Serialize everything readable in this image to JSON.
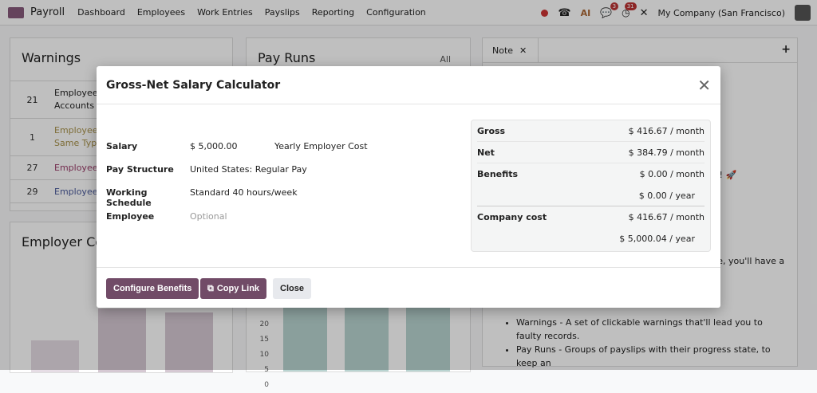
{
  "nav": {
    "app": "Payroll",
    "menu": [
      "Dashboard",
      "Employees",
      "Work Entries",
      "Payslips",
      "Reporting",
      "Configuration"
    ],
    "chat_count": "3",
    "activity_count": "31",
    "company": "My Company (San Francisco)"
  },
  "warnings": {
    "title": "Warnings",
    "rows": [
      {
        "count": "21",
        "text": "Employees",
        "text2": "Accounts",
        "color": "#333"
      },
      {
        "count": "1",
        "text": "Employees",
        "text2": "Same Type",
        "color": "#a8924a"
      },
      {
        "count": "27",
        "text": "Employees",
        "text2": "",
        "color": "#9b3d6a"
      },
      {
        "count": "29",
        "text": "Employees",
        "text2": "",
        "color": "#4a5a9b"
      }
    ]
  },
  "employer_cost": {
    "title": "Employer Co"
  },
  "pay_runs": {
    "title": "Pay Runs",
    "all": "All",
    "ticks": [
      "20",
      "15",
      "10",
      "5",
      "0"
    ]
  },
  "note": {
    "tab": "Note",
    "text1": "l ! 🚀",
    "text2": "re, you'll have a",
    "bullets": [
      "Warnings - A set of clickable warnings that'll lead you to faulty records.",
      "Pay Runs - Groups of payslips with their progress state, to keep an"
    ]
  },
  "modal": {
    "title": "Gross-Net Salary Calculator",
    "fields": [
      {
        "label": "Salary",
        "value": "$ 5,000.00",
        "extra": "Yearly Employer Cost"
      },
      {
        "label": "Pay Structure",
        "value": "United States: Regular Pay"
      },
      {
        "label": "Working Schedule",
        "value": "Standard 40 hours/week"
      },
      {
        "label": "Employee",
        "placeholder": "Optional"
      }
    ],
    "summary": {
      "gross_label": "Gross",
      "gross": "$ 416.67 / month",
      "net_label": "Net",
      "net": "$ 384.79 / month",
      "benefits_label": "Benefits",
      "benefits_month": "$ 0.00 / month",
      "benefits_year": "$ 0.00 / year",
      "company_label": "Company cost",
      "company_month": "$ 416.67 / month",
      "company_year": "$ 5,000.04 / year"
    },
    "buttons": {
      "configure": "Configure Benefits",
      "copy": "Copy Link",
      "close": "Close"
    }
  }
}
